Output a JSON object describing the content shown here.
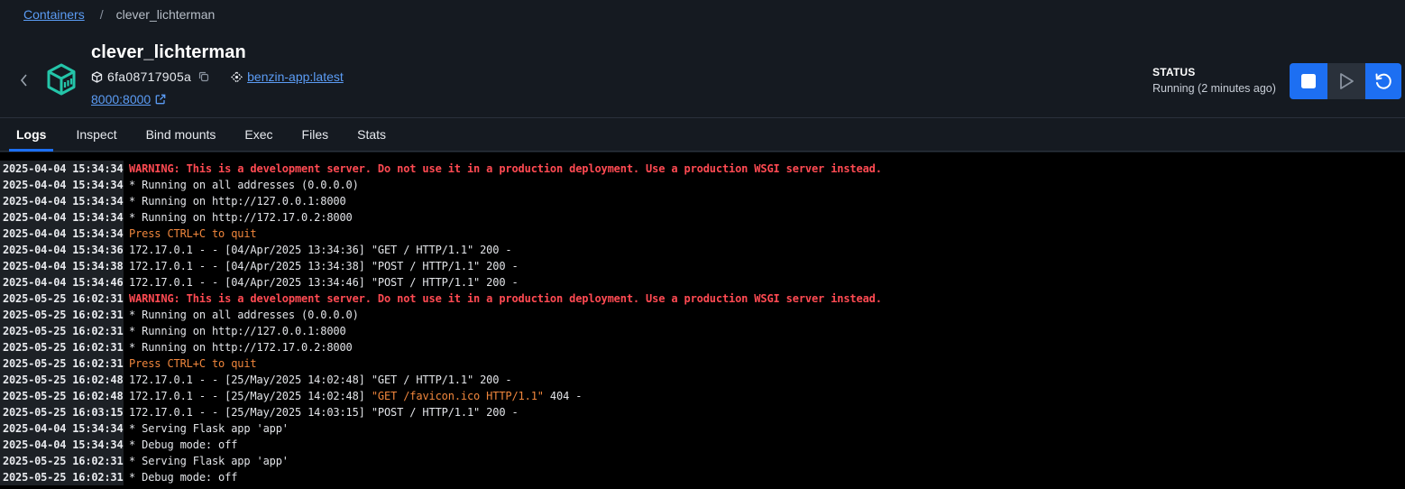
{
  "breadcrumb": {
    "parent": "Containers",
    "separator": "/",
    "current": "clever_lichterman"
  },
  "container": {
    "name": "clever_lichterman",
    "id": "6fa08717905a",
    "image": "benzin-app:latest",
    "port": "8000:8000"
  },
  "status": {
    "label": "STATUS",
    "value": "Running (2 minutes ago)"
  },
  "colors": {
    "accent": "#1d6ff2",
    "link": "#5b9cf5",
    "warning": "#ff4a52",
    "notice": "#f0863c",
    "container_icon": "#24c5a9"
  },
  "tabs": [
    "Logs",
    "Inspect",
    "Bind mounts",
    "Exec",
    "Files",
    "Stats"
  ],
  "logs": [
    {
      "ts": "2025-04-04 15:34:34",
      "msg": "WARNING: This is a development server. Do not use it in a production deployment. Use a production WSGI server instead.",
      "style": "warn"
    },
    {
      "ts": "2025-04-04 15:34:34",
      "msg": "* Running on all addresses (0.0.0.0)",
      "style": "normal"
    },
    {
      "ts": "2025-04-04 15:34:34",
      "msg": "* Running on http://127.0.0.1:8000",
      "style": "normal"
    },
    {
      "ts": "2025-04-04 15:34:34",
      "msg": "* Running on http://172.17.0.2:8000",
      "style": "normal"
    },
    {
      "ts": "2025-04-04 15:34:34",
      "msg": "Press CTRL+C to quit",
      "style": "orange"
    },
    {
      "ts": "2025-04-04 15:34:36",
      "msg": "172.17.0.1 - - [04/Apr/2025 13:34:36] \"GET / HTTP/1.1\" 200 -",
      "style": "normal"
    },
    {
      "ts": "2025-04-04 15:34:38",
      "msg": "172.17.0.1 - - [04/Apr/2025 13:34:38] \"POST / HTTP/1.1\" 200 -",
      "style": "normal"
    },
    {
      "ts": "2025-04-04 15:34:46",
      "msg": "172.17.0.1 - - [04/Apr/2025 13:34:46] \"POST / HTTP/1.1\" 200 -",
      "style": "normal"
    },
    {
      "ts": "2025-05-25 16:02:31",
      "msg": "WARNING: This is a development server. Do not use it in a production deployment. Use a production WSGI server instead.",
      "style": "warn"
    },
    {
      "ts": "2025-05-25 16:02:31",
      "msg": "* Running on all addresses (0.0.0.0)",
      "style": "normal"
    },
    {
      "ts": "2025-05-25 16:02:31",
      "msg": "* Running on http://127.0.0.1:8000",
      "style": "normal"
    },
    {
      "ts": "2025-05-25 16:02:31",
      "msg": "* Running on http://172.17.0.2:8000",
      "style": "normal"
    },
    {
      "ts": "2025-05-25 16:02:31",
      "msg": "Press CTRL+C to quit",
      "style": "orange"
    },
    {
      "ts": "2025-05-25 16:02:48",
      "msg": "172.17.0.1 - - [25/May/2025 14:02:48] \"GET / HTTP/1.1\" 200 -",
      "style": "normal"
    },
    {
      "ts": "2025-05-25 16:02:48",
      "msg_parts": [
        "172.17.0.1 - - [25/May/2025 14:02:48] ",
        "\"GET /favicon.ico HTTP/1.1\"",
        " 404 -"
      ],
      "style": "mixed"
    },
    {
      "ts": "2025-05-25 16:03:15",
      "msg": "172.17.0.1 - - [25/May/2025 14:03:15] \"POST / HTTP/1.1\" 200 -",
      "style": "normal"
    },
    {
      "ts": "2025-04-04 15:34:34",
      "msg": "* Serving Flask app 'app'",
      "style": "normal"
    },
    {
      "ts": "2025-04-04 15:34:34",
      "msg": "* Debug mode: off",
      "style": "normal"
    },
    {
      "ts": "2025-05-25 16:02:31",
      "msg": "* Serving Flask app 'app'",
      "style": "normal"
    },
    {
      "ts": "2025-05-25 16:02:31",
      "msg": "* Debug mode: off",
      "style": "normal"
    }
  ]
}
